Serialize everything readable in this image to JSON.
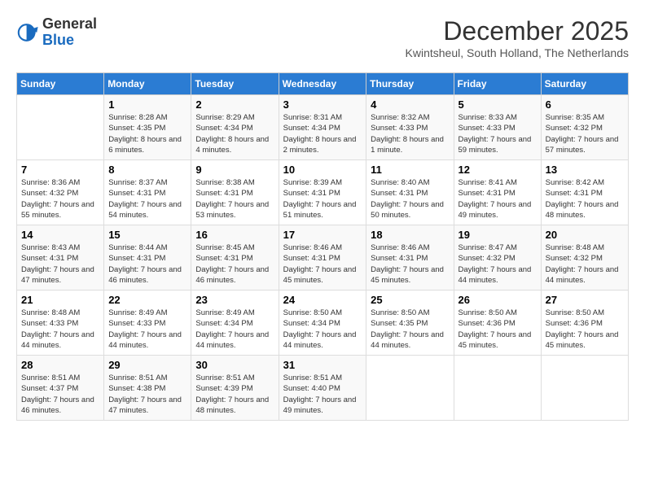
{
  "header": {
    "logo_general": "General",
    "logo_blue": "Blue",
    "month_year": "December 2025",
    "location": "Kwintsheul, South Holland, The Netherlands"
  },
  "columns": [
    "Sunday",
    "Monday",
    "Tuesday",
    "Wednesday",
    "Thursday",
    "Friday",
    "Saturday"
  ],
  "weeks": [
    [
      {
        "day": "",
        "sunrise": "",
        "sunset": "",
        "daylight": ""
      },
      {
        "day": "1",
        "sunrise": "Sunrise: 8:28 AM",
        "sunset": "Sunset: 4:35 PM",
        "daylight": "Daylight: 8 hours and 6 minutes."
      },
      {
        "day": "2",
        "sunrise": "Sunrise: 8:29 AM",
        "sunset": "Sunset: 4:34 PM",
        "daylight": "Daylight: 8 hours and 4 minutes."
      },
      {
        "day": "3",
        "sunrise": "Sunrise: 8:31 AM",
        "sunset": "Sunset: 4:34 PM",
        "daylight": "Daylight: 8 hours and 2 minutes."
      },
      {
        "day": "4",
        "sunrise": "Sunrise: 8:32 AM",
        "sunset": "Sunset: 4:33 PM",
        "daylight": "Daylight: 8 hours and 1 minute."
      },
      {
        "day": "5",
        "sunrise": "Sunrise: 8:33 AM",
        "sunset": "Sunset: 4:33 PM",
        "daylight": "Daylight: 7 hours and 59 minutes."
      },
      {
        "day": "6",
        "sunrise": "Sunrise: 8:35 AM",
        "sunset": "Sunset: 4:32 PM",
        "daylight": "Daylight: 7 hours and 57 minutes."
      }
    ],
    [
      {
        "day": "7",
        "sunrise": "Sunrise: 8:36 AM",
        "sunset": "Sunset: 4:32 PM",
        "daylight": "Daylight: 7 hours and 55 minutes."
      },
      {
        "day": "8",
        "sunrise": "Sunrise: 8:37 AM",
        "sunset": "Sunset: 4:31 PM",
        "daylight": "Daylight: 7 hours and 54 minutes."
      },
      {
        "day": "9",
        "sunrise": "Sunrise: 8:38 AM",
        "sunset": "Sunset: 4:31 PM",
        "daylight": "Daylight: 7 hours and 53 minutes."
      },
      {
        "day": "10",
        "sunrise": "Sunrise: 8:39 AM",
        "sunset": "Sunset: 4:31 PM",
        "daylight": "Daylight: 7 hours and 51 minutes."
      },
      {
        "day": "11",
        "sunrise": "Sunrise: 8:40 AM",
        "sunset": "Sunset: 4:31 PM",
        "daylight": "Daylight: 7 hours and 50 minutes."
      },
      {
        "day": "12",
        "sunrise": "Sunrise: 8:41 AM",
        "sunset": "Sunset: 4:31 PM",
        "daylight": "Daylight: 7 hours and 49 minutes."
      },
      {
        "day": "13",
        "sunrise": "Sunrise: 8:42 AM",
        "sunset": "Sunset: 4:31 PM",
        "daylight": "Daylight: 7 hours and 48 minutes."
      }
    ],
    [
      {
        "day": "14",
        "sunrise": "Sunrise: 8:43 AM",
        "sunset": "Sunset: 4:31 PM",
        "daylight": "Daylight: 7 hours and 47 minutes."
      },
      {
        "day": "15",
        "sunrise": "Sunrise: 8:44 AM",
        "sunset": "Sunset: 4:31 PM",
        "daylight": "Daylight: 7 hours and 46 minutes."
      },
      {
        "day": "16",
        "sunrise": "Sunrise: 8:45 AM",
        "sunset": "Sunset: 4:31 PM",
        "daylight": "Daylight: 7 hours and 46 minutes."
      },
      {
        "day": "17",
        "sunrise": "Sunrise: 8:46 AM",
        "sunset": "Sunset: 4:31 PM",
        "daylight": "Daylight: 7 hours and 45 minutes."
      },
      {
        "day": "18",
        "sunrise": "Sunrise: 8:46 AM",
        "sunset": "Sunset: 4:31 PM",
        "daylight": "Daylight: 7 hours and 45 minutes."
      },
      {
        "day": "19",
        "sunrise": "Sunrise: 8:47 AM",
        "sunset": "Sunset: 4:32 PM",
        "daylight": "Daylight: 7 hours and 44 minutes."
      },
      {
        "day": "20",
        "sunrise": "Sunrise: 8:48 AM",
        "sunset": "Sunset: 4:32 PM",
        "daylight": "Daylight: 7 hours and 44 minutes."
      }
    ],
    [
      {
        "day": "21",
        "sunrise": "Sunrise: 8:48 AM",
        "sunset": "Sunset: 4:33 PM",
        "daylight": "Daylight: 7 hours and 44 minutes."
      },
      {
        "day": "22",
        "sunrise": "Sunrise: 8:49 AM",
        "sunset": "Sunset: 4:33 PM",
        "daylight": "Daylight: 7 hours and 44 minutes."
      },
      {
        "day": "23",
        "sunrise": "Sunrise: 8:49 AM",
        "sunset": "Sunset: 4:34 PM",
        "daylight": "Daylight: 7 hours and 44 minutes."
      },
      {
        "day": "24",
        "sunrise": "Sunrise: 8:50 AM",
        "sunset": "Sunset: 4:34 PM",
        "daylight": "Daylight: 7 hours and 44 minutes."
      },
      {
        "day": "25",
        "sunrise": "Sunrise: 8:50 AM",
        "sunset": "Sunset: 4:35 PM",
        "daylight": "Daylight: 7 hours and 44 minutes."
      },
      {
        "day": "26",
        "sunrise": "Sunrise: 8:50 AM",
        "sunset": "Sunset: 4:36 PM",
        "daylight": "Daylight: 7 hours and 45 minutes."
      },
      {
        "day": "27",
        "sunrise": "Sunrise: 8:50 AM",
        "sunset": "Sunset: 4:36 PM",
        "daylight": "Daylight: 7 hours and 45 minutes."
      }
    ],
    [
      {
        "day": "28",
        "sunrise": "Sunrise: 8:51 AM",
        "sunset": "Sunset: 4:37 PM",
        "daylight": "Daylight: 7 hours and 46 minutes."
      },
      {
        "day": "29",
        "sunrise": "Sunrise: 8:51 AM",
        "sunset": "Sunset: 4:38 PM",
        "daylight": "Daylight: 7 hours and 47 minutes."
      },
      {
        "day": "30",
        "sunrise": "Sunrise: 8:51 AM",
        "sunset": "Sunset: 4:39 PM",
        "daylight": "Daylight: 7 hours and 48 minutes."
      },
      {
        "day": "31",
        "sunrise": "Sunrise: 8:51 AM",
        "sunset": "Sunset: 4:40 PM",
        "daylight": "Daylight: 7 hours and 49 minutes."
      },
      {
        "day": "",
        "sunrise": "",
        "sunset": "",
        "daylight": ""
      },
      {
        "day": "",
        "sunrise": "",
        "sunset": "",
        "daylight": ""
      },
      {
        "day": "",
        "sunrise": "",
        "sunset": "",
        "daylight": ""
      }
    ]
  ]
}
